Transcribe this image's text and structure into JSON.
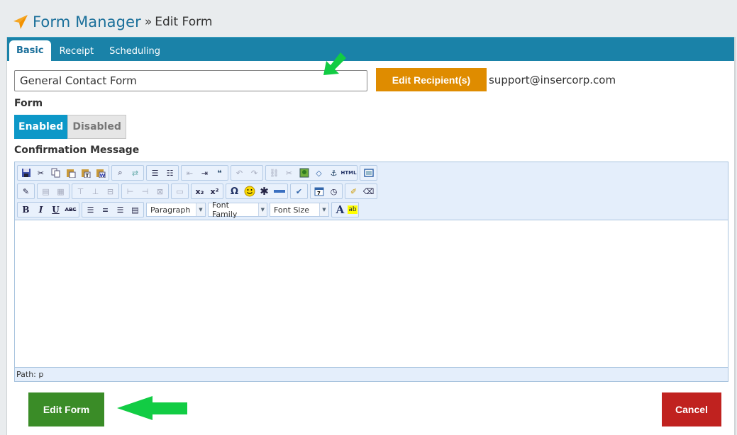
{
  "header": {
    "title": "Form Manager",
    "separator": "»",
    "subtitle": "Edit Form",
    "icon": "paper-plane-icon"
  },
  "tabs": [
    {
      "label": "Basic",
      "active": true
    },
    {
      "label": "Receipt",
      "active": false
    },
    {
      "label": "Scheduling",
      "active": false
    }
  ],
  "form": {
    "name_value": "General Contact Form",
    "edit_recipients_label": "Edit Recipient(s)",
    "recipient_email": "support@insercorp.com",
    "status_label": "Form",
    "status_options": [
      "Enabled",
      "Disabled"
    ],
    "status_selected": "Enabled",
    "confirmation_label": "Confirmation Message"
  },
  "editor": {
    "toolbar_row1": [
      "save-icon",
      "cut-icon",
      "copy-icon",
      "paste-icon",
      "paste-text-icon",
      "paste-word-icon",
      "find-icon",
      "replace-icon",
      "bullet-list-icon",
      "numbered-list-icon",
      "outdent-icon",
      "indent-icon",
      "blockquote-icon",
      "undo-icon",
      "redo-icon",
      "link-icon",
      "unlink-icon",
      "image-icon",
      "code-icon",
      "anchor-icon",
      "html-icon",
      "fullscreen-icon"
    ],
    "toolbar_row2": [
      "edit-icon",
      "table-row-props-icon",
      "table-cell-props-icon",
      "insert-row-before-icon",
      "insert-row-after-icon",
      "delete-row-icon",
      "insert-col-before-icon",
      "insert-col-after-icon",
      "delete-col-icon",
      "table-icon",
      "subscript-icon",
      "superscript-icon",
      "special-char-icon",
      "emoticon-icon",
      "asterisk-icon",
      "horizontal-rule-icon",
      "spellcheck-icon",
      "insert-date-icon",
      "insert-time-icon",
      "cleanup-icon",
      "remove-format-icon"
    ],
    "toolbar_row3": [
      "bold-icon",
      "italic-icon",
      "underline-icon",
      "strikethrough-icon",
      "align-left-icon",
      "align-center-icon",
      "align-right-icon",
      "justify-icon",
      "text-color-icon",
      "highlight-color-icon"
    ],
    "labels": {
      "html": "HTML",
      "abc": "ABC",
      "omega": "Ω"
    },
    "paragraph_select": "Paragraph",
    "font_family_select": "Font Family",
    "font_size_select": "Font Size",
    "content": "",
    "path": "Path: p"
  },
  "actions": {
    "edit_form_label": "Edit Form",
    "cancel_label": "Cancel"
  },
  "colors": {
    "accent": "#1a82a8",
    "orange": "#df8c00",
    "green": "#3a8c27",
    "red": "#c0221f",
    "arrow": "#12cc44"
  }
}
